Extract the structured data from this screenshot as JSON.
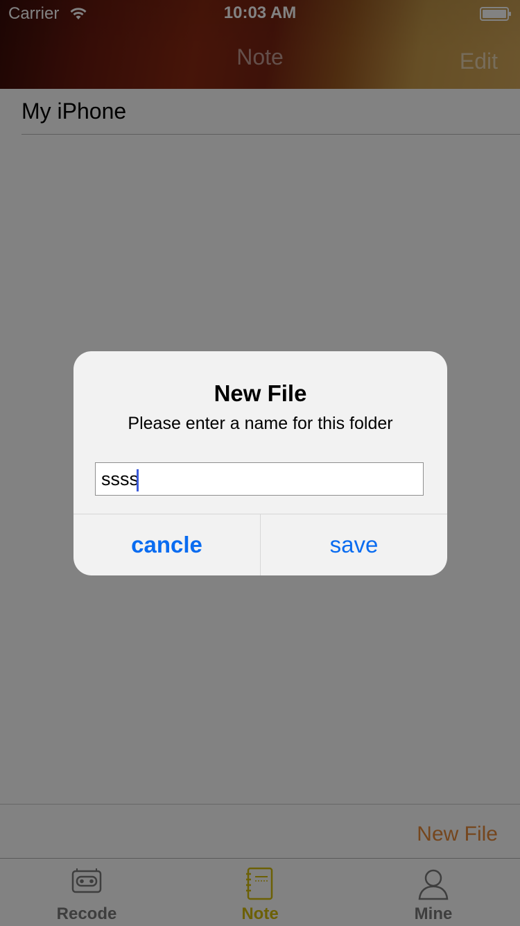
{
  "status_bar": {
    "carrier": "Carrier",
    "time": "10:03 AM",
    "wifi_icon": "wifi-icon",
    "battery_icon": "battery-icon"
  },
  "nav": {
    "title": "Note",
    "edit_label": "Edit"
  },
  "list": {
    "items": [
      {
        "label": "My iPhone"
      }
    ]
  },
  "toolbar": {
    "new_file_label": "New File",
    "new_file_color": "#e58a3a"
  },
  "tab_bar": {
    "tabs": [
      {
        "label": "Recode",
        "icon": "cassette-icon",
        "active": false
      },
      {
        "label": "Note",
        "icon": "notebook-icon",
        "active": true
      },
      {
        "label": "Mine",
        "icon": "person-icon",
        "active": false
      }
    ],
    "active_color": "#d4bc0a",
    "inactive_color": "#7a7a7a"
  },
  "alert": {
    "title": "New File",
    "message": "Please enter a name for this folder",
    "input_value": "ssss",
    "cancel_label": "cancle",
    "save_label": "save",
    "button_color": "#0a6cf0"
  }
}
